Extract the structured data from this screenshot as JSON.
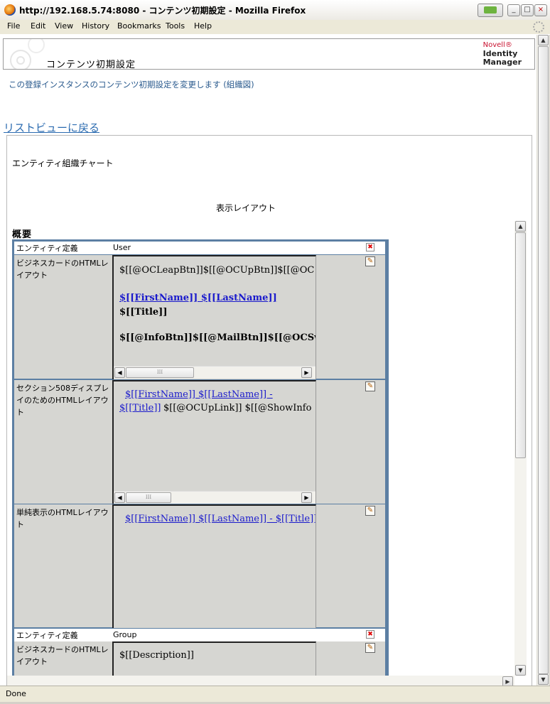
{
  "window": {
    "title": "http://192.168.5.74:8080 - コンテンツ初期設定 - Mozilla Firefox",
    "minimize_glyph": "_",
    "maximize_glyph": "□",
    "close_glyph": "×"
  },
  "menu": [
    "File",
    "Edit",
    "View",
    "History",
    "Bookmarks",
    "Tools",
    "Help"
  ],
  "header": {
    "page_title": "コンテンツ初期設定",
    "brand_line1": "Novell®",
    "brand_line2": "Identity",
    "brand_line3": "Manager"
  },
  "description": "この登録インスタンスのコンテンツ初期設定を変更します (組織図)",
  "back_link": "リストビューに戻る",
  "panel": {
    "title": "エンティティ組織チャート",
    "layout_label": "表示レイアウト",
    "section": "概要"
  },
  "entities": [
    {
      "def_label": "エンティティ定義",
      "def_value": "User",
      "rows": [
        {
          "label": "ビジネスカードのHTMLレイアウト",
          "lines": [
            "$[[@OCLeapBtn]]$[[@OCUpBtn]]$[[@OC",
            "$[[FirstName]] $[[LastName]]",
            "$[[Title]]",
            "$[[@InfoBtn]]$[[@MailBtn]]$[[@OCSwi"
          ]
        },
        {
          "label": "セクション508ディスプレイのためのHTMLレイアウト",
          "lines": [
            "$[[FirstName]] $[[LastName]] -",
            "$[[Title]]",
            "$[[@OCUpLink]]  $[[@ShowInfo"
          ]
        },
        {
          "label": "単純表示のHTMLレイアウト",
          "lines": [
            "$[[FirstName]] $[[LastName]] - $[[Title]]"
          ]
        }
      ]
    },
    {
      "def_label": "エンティティ定義",
      "def_value": "Group",
      "rows": [
        {
          "label": "ビジネスカードのHTMLレイアウト",
          "lines": [
            "$[[Description]]"
          ]
        }
      ]
    }
  ],
  "scroll_glyphs": {
    "up": "▲",
    "down": "▼",
    "left": "◀",
    "right": "▶",
    "grip": "III"
  },
  "status": "Done"
}
